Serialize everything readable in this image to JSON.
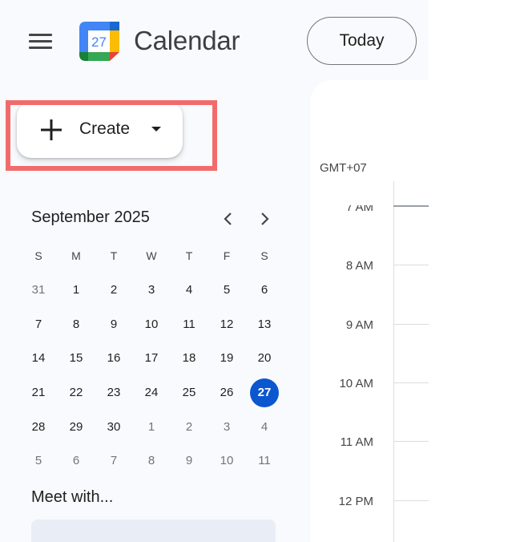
{
  "header": {
    "menu_icon": "hamburger-menu-icon",
    "logo_text": "27",
    "app_title": "Calendar",
    "today_label": "Today"
  },
  "create": {
    "label": "Create",
    "plus_icon": "plus-icon",
    "caret_icon": "caret-down-icon"
  },
  "colors": {
    "accent_blue": "#0b57d0",
    "highlight_red": "#f26b6b",
    "app_bg": "#f8fafd"
  },
  "mini_calendar": {
    "month_label": "September 2025",
    "prev_icon": "chevron-left-icon",
    "next_icon": "chevron-right-icon",
    "weekdays": [
      "S",
      "M",
      "T",
      "W",
      "T",
      "F",
      "S"
    ],
    "weeks": [
      [
        "31",
        "1",
        "2",
        "3",
        "4",
        "5",
        "6"
      ],
      [
        "7",
        "8",
        "9",
        "10",
        "11",
        "12",
        "13"
      ],
      [
        "14",
        "15",
        "16",
        "17",
        "18",
        "19",
        "20"
      ],
      [
        "21",
        "22",
        "23",
        "24",
        "25",
        "26",
        "27"
      ],
      [
        "28",
        "29",
        "30",
        "1",
        "2",
        "3",
        "4"
      ],
      [
        "5",
        "6",
        "7",
        "8",
        "9",
        "10",
        "11"
      ]
    ],
    "today": "27"
  },
  "meet_with": {
    "label": "Meet with..."
  },
  "day_view": {
    "timezone": "GMT+07",
    "hours": [
      "7 AM",
      "8 AM",
      "9 AM",
      "10 AM",
      "11 AM",
      "12 PM"
    ]
  }
}
